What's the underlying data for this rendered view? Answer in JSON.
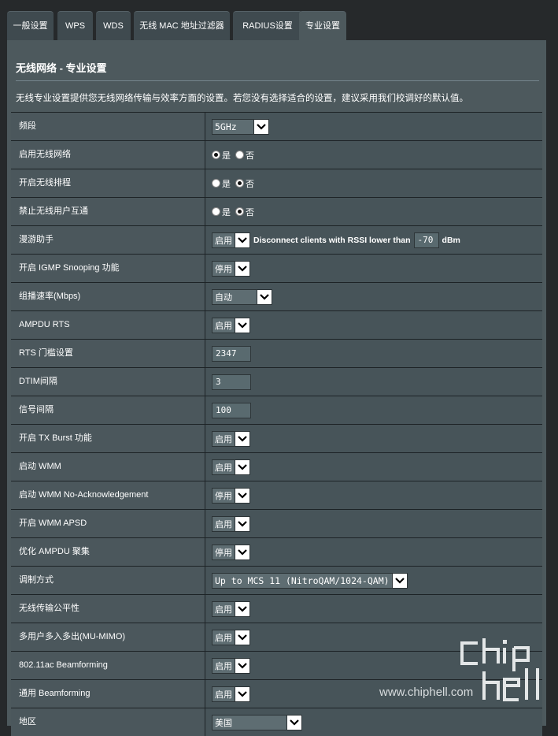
{
  "tabs": [
    "一般设置",
    "WPS",
    "WDS",
    "无线 MAC 地址过滤器",
    "RADIUS设置",
    "专业设置"
  ],
  "active_tab": "专业设置",
  "page_title": "无线网络 - 专业设置",
  "description": "无线专业设置提供您无线网络传输与效率方面的设置。若您没有选择适合的设置，建议采用我们校调好的默认值。",
  "rows": [
    {
      "label": "频段",
      "type": "select",
      "value": "5GHz"
    },
    {
      "label": "启用无线网络",
      "type": "radio",
      "options": [
        "是",
        "否"
      ],
      "selected": "是"
    },
    {
      "label": "开启无线排程",
      "type": "radio",
      "options": [
        "是",
        "否"
      ],
      "selected": "否"
    },
    {
      "label": "禁止无线用户互通",
      "type": "radio",
      "options": [
        "是",
        "否"
      ],
      "selected": "否"
    },
    {
      "label": "漫游助手",
      "type": "roaming",
      "value": "启用",
      "text_before": "Disconnect clients with RSSI lower than",
      "rssi": "-70",
      "unit": "dBm"
    },
    {
      "label": "开启 IGMP Snooping 功能",
      "type": "select",
      "value": "停用"
    },
    {
      "label": "组播速率(Mbps)",
      "type": "select",
      "value": "自动"
    },
    {
      "label": "AMPDU RTS",
      "type": "select",
      "value": "启用"
    },
    {
      "label": "RTS 门槛设置",
      "type": "input",
      "value": "2347"
    },
    {
      "label": "DTIM间隔",
      "type": "input",
      "value": "3"
    },
    {
      "label": "信号间隔",
      "type": "input",
      "value": "100"
    },
    {
      "label": "开启 TX Burst 功能",
      "type": "select",
      "value": "启用"
    },
    {
      "label": "启动 WMM",
      "type": "select",
      "value": "启用"
    },
    {
      "label": "启动 WMM No-Acknowledgement",
      "type": "select",
      "value": "停用"
    },
    {
      "label": "开启 WMM APSD",
      "type": "select",
      "value": "启用"
    },
    {
      "label": "优化 AMPDU 聚集",
      "type": "select",
      "value": "停用"
    },
    {
      "label": "调制方式",
      "type": "select",
      "value": "Up to MCS 11 (NitroQAM/1024-QAM)"
    },
    {
      "label": "无线传输公平性",
      "type": "select",
      "value": "启用"
    },
    {
      "label": "多用户多入多出(MU-MIMO)",
      "type": "select",
      "value": "启用"
    },
    {
      "label": "802.11ac Beamforming",
      "type": "select",
      "value": "启用"
    },
    {
      "label": "通用 Beamforming",
      "type": "select",
      "value": "启用"
    },
    {
      "label": "地区",
      "type": "select",
      "value": "美国"
    }
  ],
  "watermark": "www.chiphell.com",
  "colors": {
    "panel": "#4d595d",
    "background": "#26292b",
    "divider": "#1d2326"
  }
}
